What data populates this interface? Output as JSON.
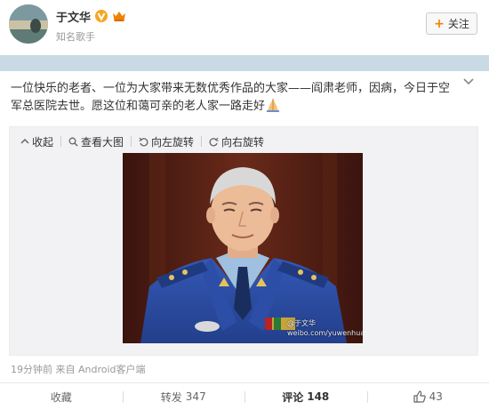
{
  "user": {
    "name": "于文华",
    "subtitle": "知名歌手",
    "follow_label": "关注"
  },
  "post": {
    "text": "一位快乐的老者、一位为大家带来无数优秀作品的大家——阎肃老师，因病，今日于空军总医院去世。愿这位和蔼可亲的老人家一路走好",
    "emoji_icon": "pray-icon"
  },
  "media": {
    "toolbar": [
      {
        "label": "收起",
        "icon": "collapse-icon"
      },
      {
        "label": "查看大图",
        "icon": "magnify-icon"
      },
      {
        "label": "向左旋转",
        "icon": "rotate-left-icon"
      },
      {
        "label": "向右旋转",
        "icon": "rotate-right-icon"
      }
    ],
    "watermark_line1": "@于文华",
    "watermark_line2": "weibo.com/yuwenhua"
  },
  "meta": {
    "time": "19分钟前",
    "source": "来自 Android客户端"
  },
  "actions": {
    "favorite": "收藏",
    "repost_label": "转发",
    "repost_count": "347",
    "comment_label": "评论",
    "comment_count": "148",
    "like_count": "43"
  },
  "colors": {
    "accent_orange": "#f08200",
    "band_blue": "#c8dbe5",
    "uniform_blue": "#2a4fa8"
  }
}
